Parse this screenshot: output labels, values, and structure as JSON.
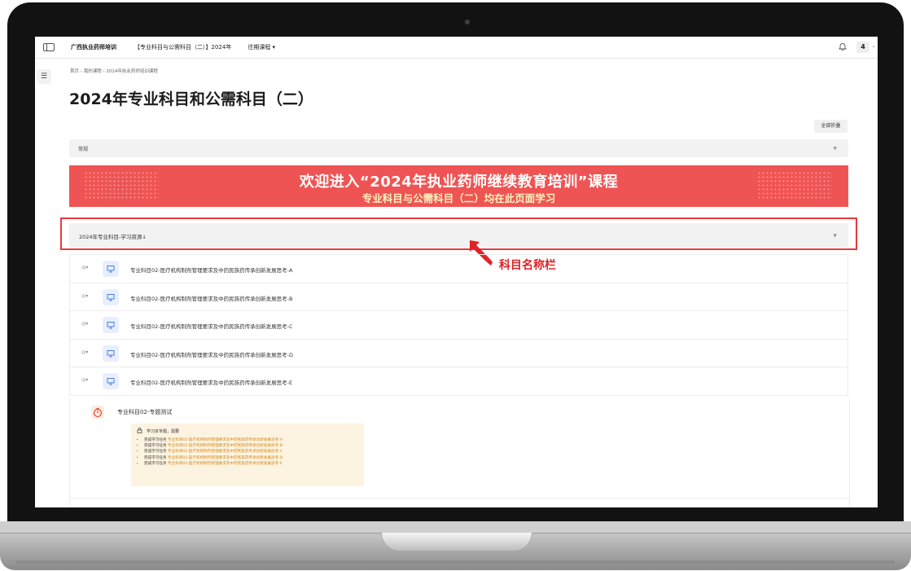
{
  "topbar": {
    "site_name": "广西执业药师培训",
    "course_tab": "【专业科目与公需科目（二）】2024年",
    "past_courses": "往期课程 ▾",
    "notification_count": "4"
  },
  "breadcrumb": "首页 › 我的课程 › 2024年执业药师培训课程",
  "page_title": "2024年专业科目和公需科目（二）",
  "collapse_all_label": "全部折叠",
  "sections": {
    "general": "常规",
    "resource": "2024年专业科目-学习资源↓"
  },
  "banner": {
    "title": "欢迎进入“2024年执业药师继续教育培训”课程",
    "subtitle": "专业科目与公需科目（二）均在此页面学习"
  },
  "annotation": {
    "label": "科目名称栏",
    "color": "#e12226"
  },
  "activities": [
    {
      "label": "专业科目02-医疗机构制剂管理要求及中药民族药传承创新发展思考-A"
    },
    {
      "label": "专业科目02-医疗机构制剂管理要求及中药民族药传承创新发展思考-B"
    },
    {
      "label": "专业科目02-医疗机构制剂管理要求及中药民族药传承创新发展思考-C"
    },
    {
      "label": "专业科目02-医疗机构制剂管理要求及中药民族药传承创新发展思考-D"
    },
    {
      "label": "专业科目02-医疗机构制剂管理要求及中药民族药传承创新发展思考-E"
    }
  ],
  "quiz": {
    "label": "专业科目02-专题测试",
    "restriction_head": "学习本专题，需要",
    "requirements": [
      {
        "prefix": "完成学习任务",
        "link": "专业科目02-医疗机构制剂管理要求及中药民族药传承创新发展思考-A"
      },
      {
        "prefix": "完成学习任务",
        "link": "专业科目02-医疗机构制剂管理要求及中药民族药传承创新发展思考-B"
      },
      {
        "prefix": "完成学习任务",
        "link": "专业科目02-医疗机构制剂管理要求及中药民族药传承创新发展思考-C"
      },
      {
        "prefix": "完成学习任务",
        "link": "专业科目02-医疗机构制剂管理要求及中药民族药传承创新发展思考-D"
      },
      {
        "prefix": "完成学习任务",
        "link": "专业科目02-医疗机构制剂管理要求及中药民族药传承创新发展思考-E"
      }
    ]
  },
  "icons": {
    "eye": "eye-icon",
    "activity": "monitor-icon",
    "quiz": "stopwatch-icon",
    "lock": "lock-icon",
    "bell": "bell-icon"
  }
}
